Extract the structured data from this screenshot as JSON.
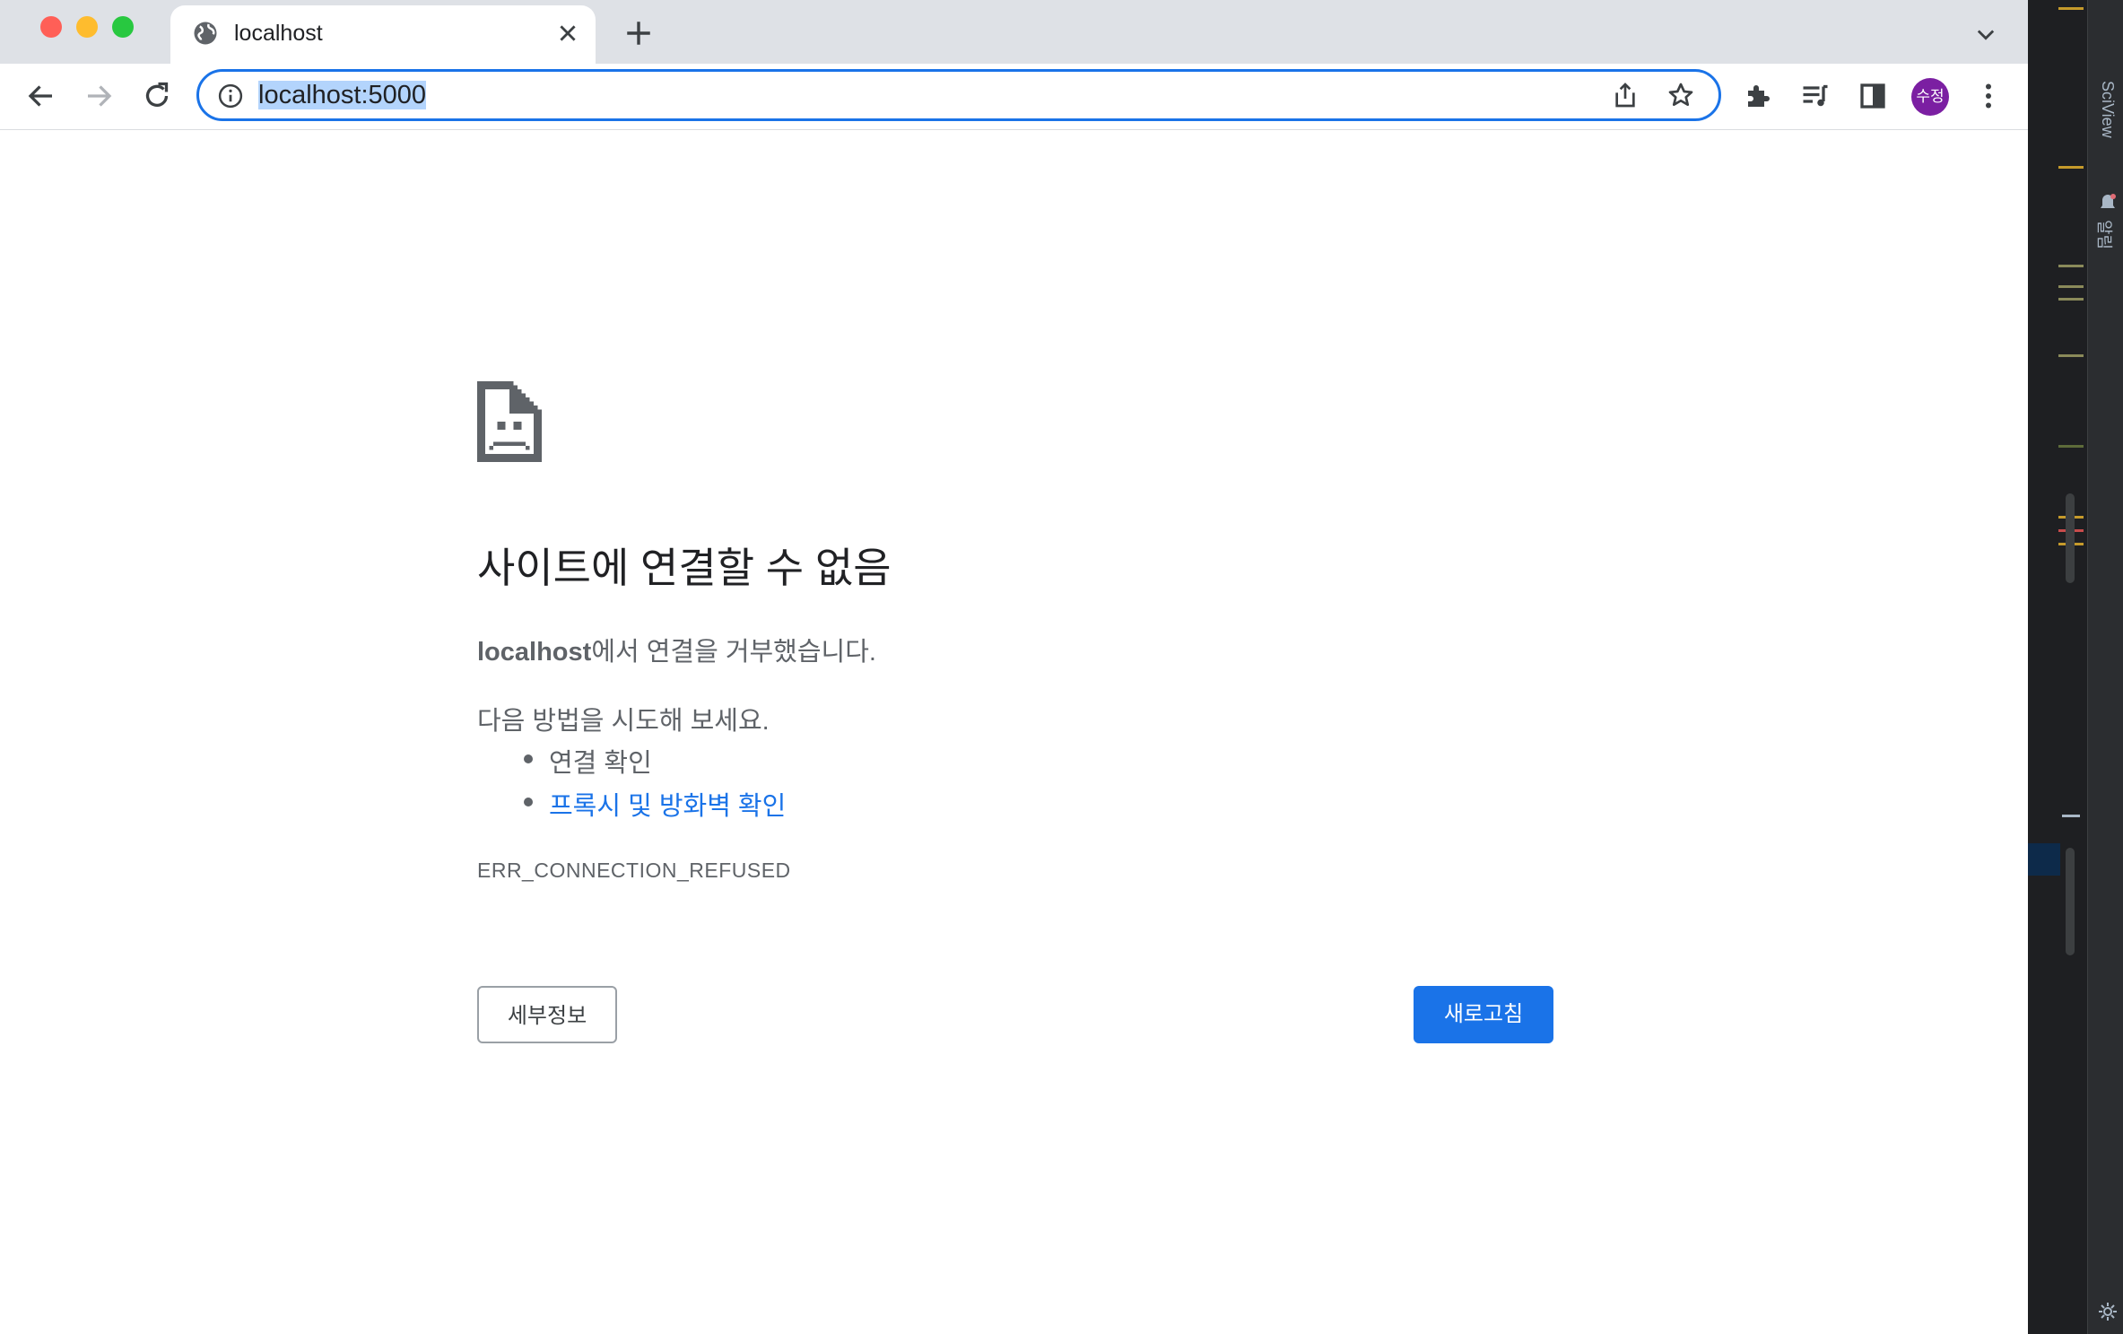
{
  "tab": {
    "title": "localhost"
  },
  "omnibox": {
    "url": "localhost:5000"
  },
  "profile": {
    "avatar_text": "수정"
  },
  "error": {
    "title": "사이트에 연결할 수 없음",
    "host": "localhost",
    "desc_suffix": "에서 연결을 거부했습니다.",
    "try_intro": "다음 방법을 시도해 보세요.",
    "suggestions": [
      "연결 확인",
      "프록시 및 방화벽 확인"
    ],
    "code": "ERR_CONNECTION_REFUSED",
    "details_button": "세부정보",
    "reload_button": "새로고침"
  },
  "ide": {
    "sciview_label": "SciView",
    "notifications_label": "알림"
  },
  "colors": {
    "accent": "#1a73e8",
    "avatar": "#7b1fa2",
    "text_muted": "#5f6368"
  }
}
